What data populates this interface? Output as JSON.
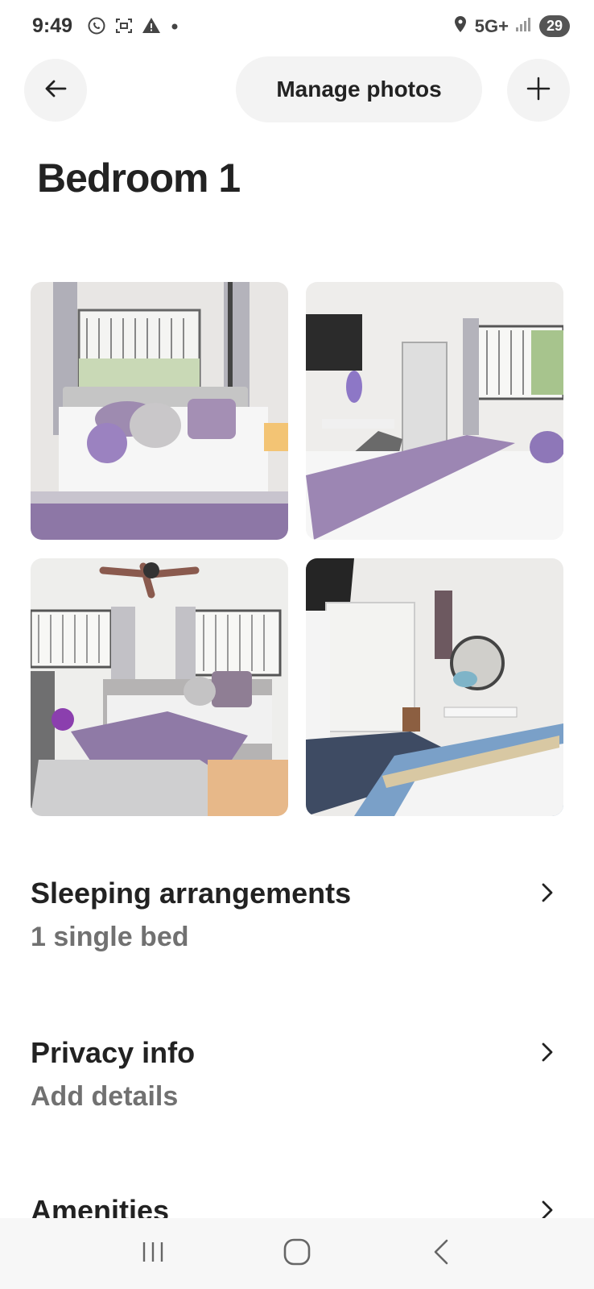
{
  "status_bar": {
    "time": "9:49",
    "network": "5G+",
    "battery": "29",
    "icons": [
      "whatsapp-icon",
      "screenshot-icon",
      "warning-icon",
      "dot-icon",
      "location-icon",
      "signal-icon"
    ]
  },
  "header": {
    "manage_photos_label": "Manage photos",
    "back_icon": "arrow-left-icon",
    "add_icon": "plus-icon"
  },
  "page": {
    "title": "Bedroom 1"
  },
  "photos": [
    {
      "name": "bedroom-photo-1"
    },
    {
      "name": "bedroom-photo-2"
    },
    {
      "name": "bedroom-photo-3"
    },
    {
      "name": "bedroom-photo-4"
    }
  ],
  "sections": [
    {
      "title": "Sleeping arrangements",
      "subtitle": "1 single bed"
    },
    {
      "title": "Privacy info",
      "subtitle": "Add details"
    },
    {
      "title": "Amenities",
      "subtitle": ""
    }
  ],
  "bottom_nav": {
    "icons": [
      "recent-apps-icon",
      "home-icon",
      "back-icon"
    ]
  },
  "colors": {
    "text_primary": "#222222",
    "text_secondary": "#717171",
    "button_bg": "#f3f3f3"
  }
}
